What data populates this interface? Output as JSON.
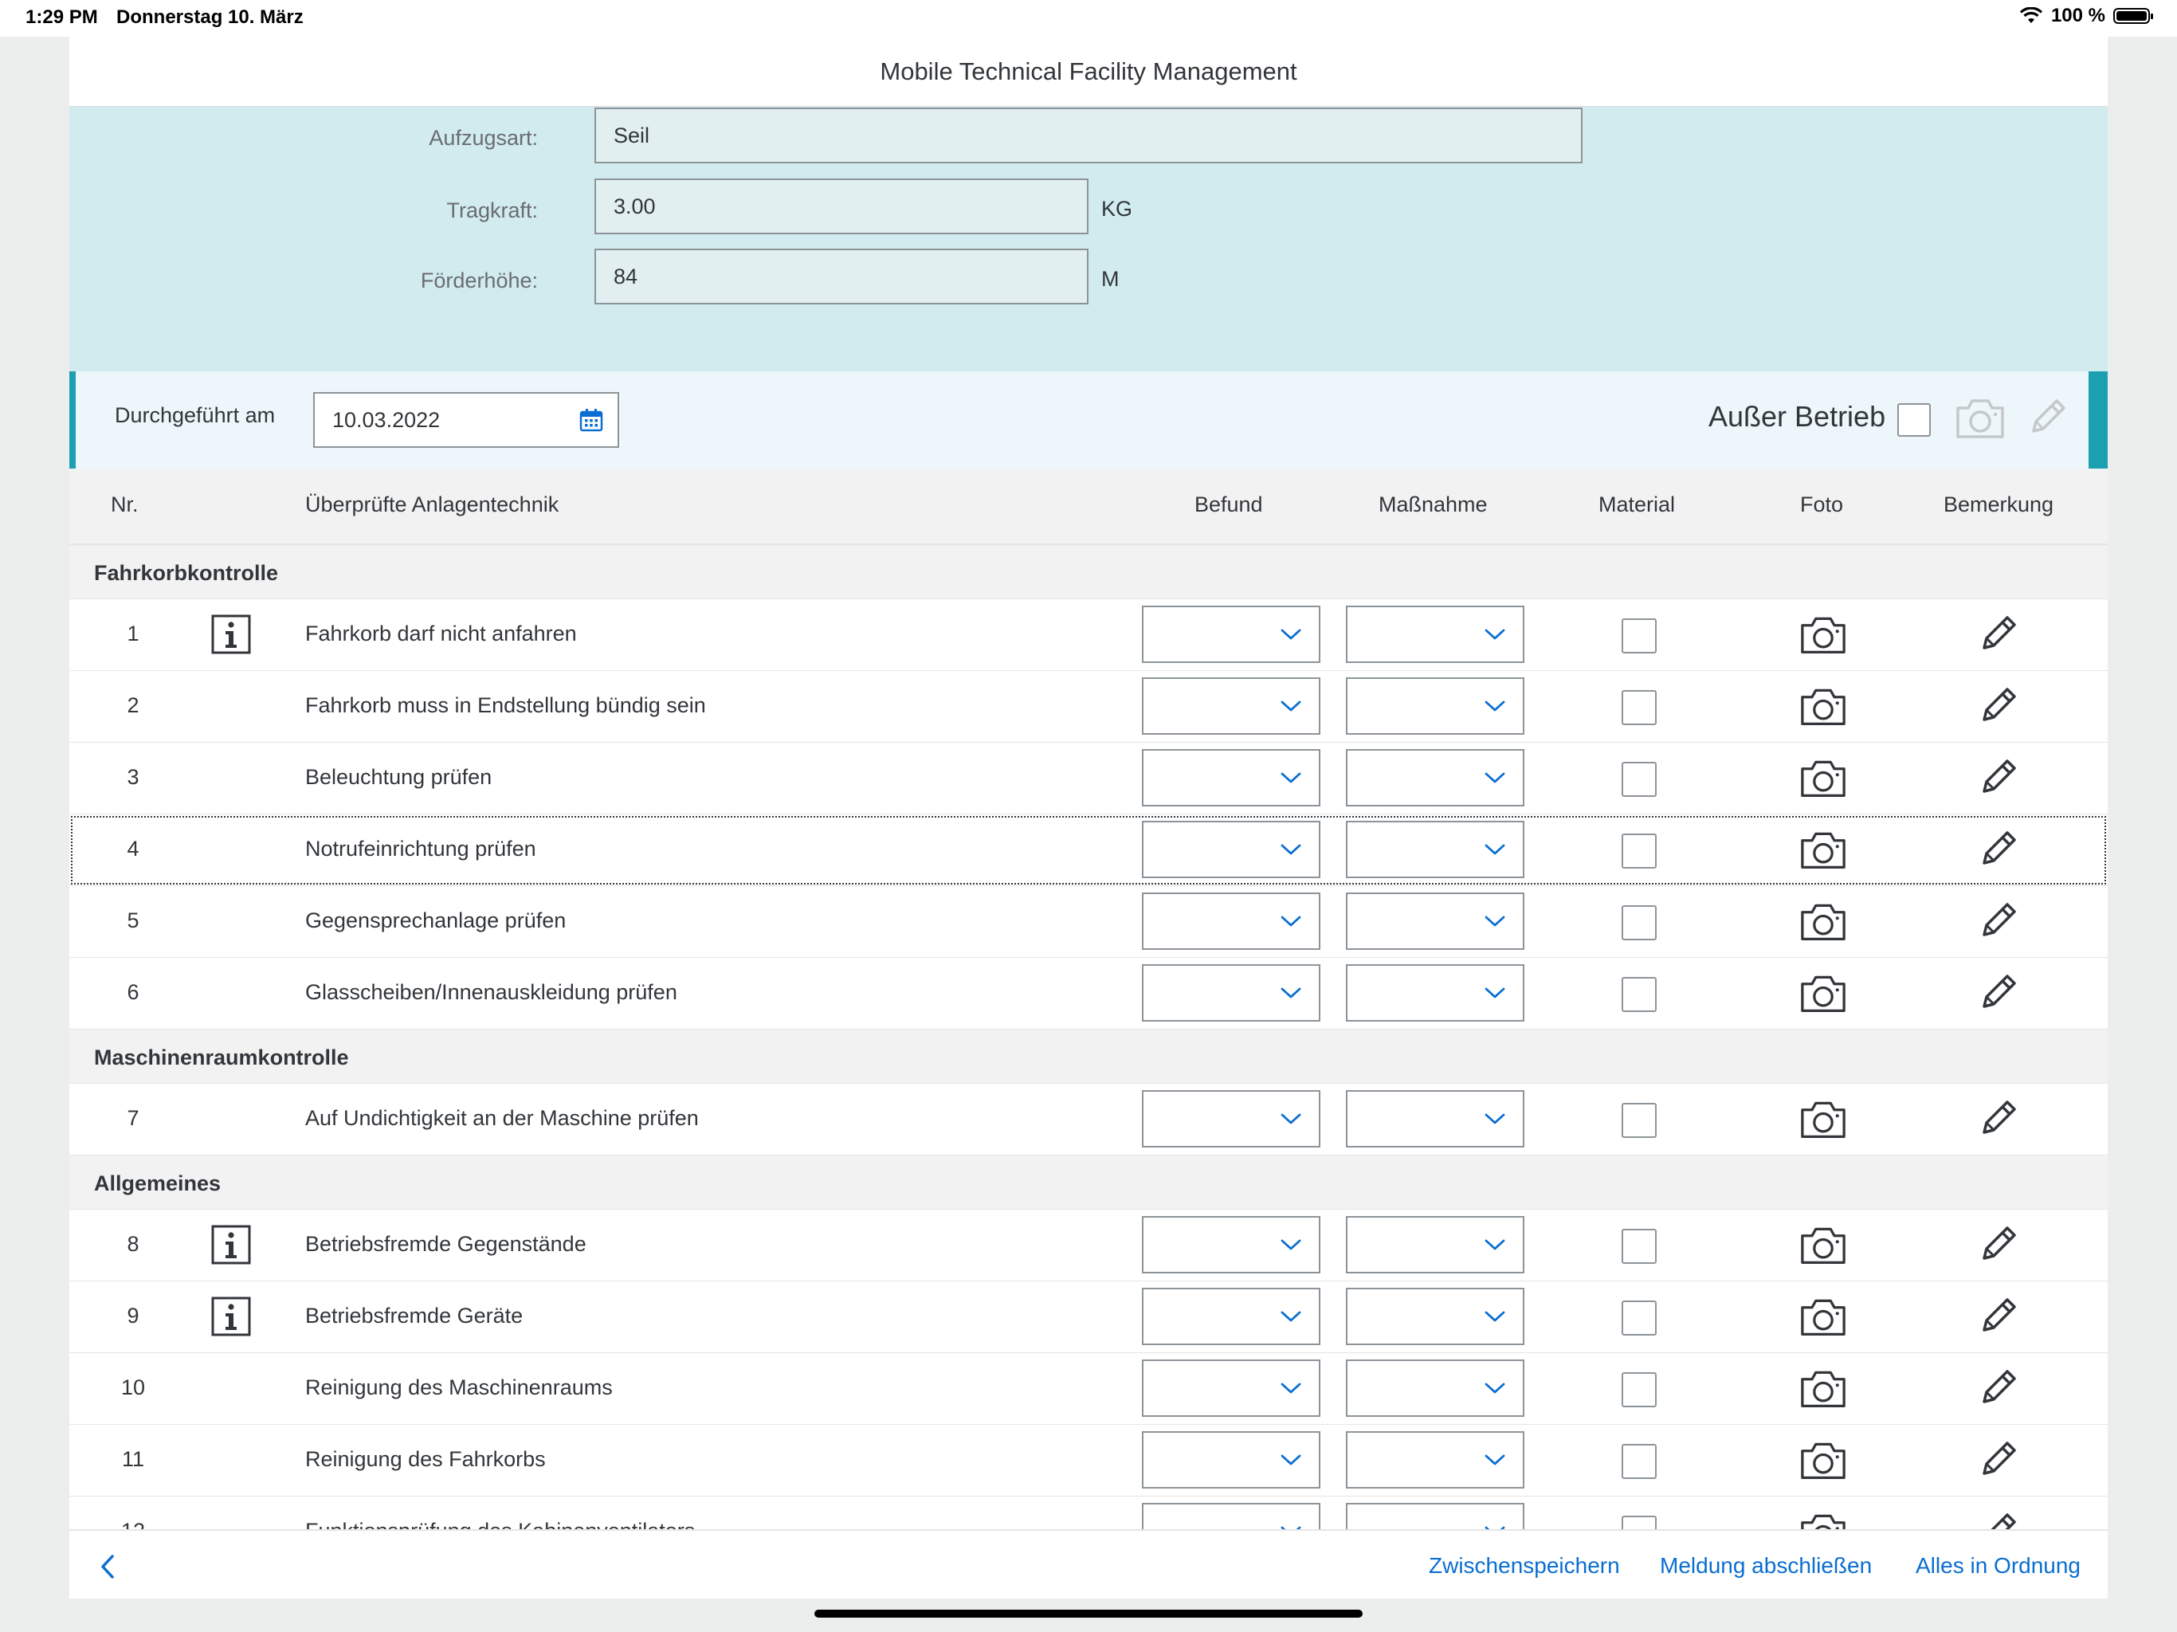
{
  "status_bar": {
    "time": "1:29 PM",
    "date": "Donnerstag 10. März",
    "battery": "100 %"
  },
  "app": {
    "title": "Mobile Technical Facility Management"
  },
  "header_fields": {
    "aufzugsart": {
      "label": "Aufzugsart:",
      "value": "Seil"
    },
    "tragkraft": {
      "label": "Tragkraft:",
      "value": "3.00",
      "unit": "KG"
    },
    "foerderhoehe": {
      "label": "Förderhöhe:",
      "value": "84",
      "unit": "M"
    }
  },
  "date_bar": {
    "label": "Durchgeführt am",
    "value": "10.03.2022",
    "out_of_service_label": "Außer Betrieb"
  },
  "columns": {
    "nr": "Nr.",
    "item": "Überprüfte Anlagentechnik",
    "befund": "Befund",
    "massnahme": "Maßnahme",
    "material": "Material",
    "foto": "Foto",
    "bemerkung": "Bemerkung"
  },
  "groups": [
    {
      "title": "Fahrkorbkontrolle",
      "rows": [
        {
          "nr": "1",
          "text": "Fahrkorb darf nicht anfahren",
          "info": true
        },
        {
          "nr": "2",
          "text": "Fahrkorb muss in Endstellung bündig sein",
          "info": false
        },
        {
          "nr": "3",
          "text": "Beleuchtung prüfen",
          "info": false
        },
        {
          "nr": "4",
          "text": "Notrufeinrichtung prüfen",
          "info": false,
          "focused": true
        },
        {
          "nr": "5",
          "text": "Gegensprechanlage prüfen",
          "info": false
        },
        {
          "nr": "6",
          "text": "Glasscheiben/Innenauskleidung prüfen",
          "info": false
        }
      ]
    },
    {
      "title": "Maschinenraumkontrolle",
      "rows": [
        {
          "nr": "7",
          "text": "Auf Undichtigkeit an der Maschine prüfen",
          "info": false
        }
      ]
    },
    {
      "title": "Allgemeines",
      "rows": [
        {
          "nr": "8",
          "text": "Betriebsfremde Gegenstände",
          "info": true
        },
        {
          "nr": "9",
          "text": "Betriebsfremde Geräte",
          "info": true
        },
        {
          "nr": "10",
          "text": "Reinigung des Maschinenraums",
          "info": false
        },
        {
          "nr": "11",
          "text": "Reinigung des Fahrkorbs",
          "info": false
        },
        {
          "nr": "12",
          "text": "Funktionsprüfung des Kabinenventilators",
          "info": false
        }
      ]
    }
  ],
  "footer": {
    "save": "Zwischenspeichern",
    "complete": "Meldung abschließen",
    "all_ok": "Alles in Ordnung"
  }
}
